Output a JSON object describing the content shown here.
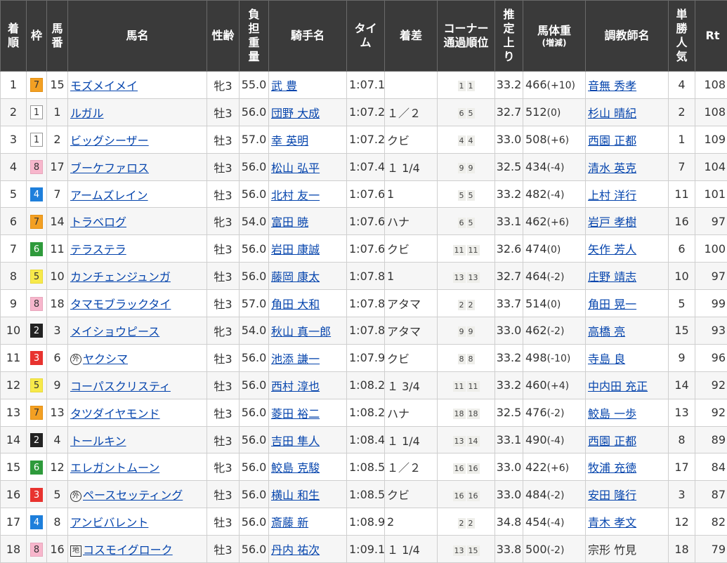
{
  "headers": {
    "rank": [
      "着",
      "順"
    ],
    "waku": "枠",
    "num": [
      "馬",
      "番"
    ],
    "name": "馬名",
    "sexage": "性齢",
    "weight": [
      "負",
      "担",
      "重",
      "量"
    ],
    "jockey": "騎手名",
    "time": [
      "タイ",
      "ム"
    ],
    "margin": "着差",
    "corner": [
      "コーナー",
      "通過順位"
    ],
    "last3f": [
      "推",
      "定",
      "上",
      "り"
    ],
    "body": [
      "馬体重",
      "(増減)"
    ],
    "trainer": "調教師名",
    "pop": [
      "単",
      "勝",
      "人",
      "気"
    ],
    "rt": "Rt"
  },
  "waku_colors": {
    "1": "#ffffff",
    "2": "#222222",
    "3": "#e8332f",
    "4": "#1e7fdb",
    "5": "#f7e94a",
    "6": "#2e9a3b",
    "7": "#f3a023",
    "8": "#f7b6cc"
  },
  "rows": [
    {
      "rank": "1",
      "waku": "7",
      "num": "15",
      "mark": "",
      "horse": "モズメイメイ",
      "sexage": "牝3",
      "weight": "55.0",
      "jockey": "武 豊",
      "time": "1:07.1",
      "margin": "",
      "corner": [
        "1",
        "1"
      ],
      "last3f": "33.2",
      "body": "466",
      "diff": "(+10)",
      "trainer": "音無 秀孝",
      "trainer_link": true,
      "pop": "4",
      "rt": "108"
    },
    {
      "rank": "2",
      "waku": "1",
      "num": "1",
      "mark": "",
      "horse": "ルガル",
      "sexage": "牡3",
      "weight": "56.0",
      "jockey": "団野 大成",
      "time": "1:07.2",
      "margin": "１／２",
      "corner": [
        "6",
        "5"
      ],
      "last3f": "32.7",
      "body": "512",
      "diff": "(0)",
      "trainer": "杉山 晴紀",
      "trainer_link": true,
      "pop": "2",
      "rt": "108"
    },
    {
      "rank": "3",
      "waku": "1",
      "num": "2",
      "mark": "",
      "horse": "ビッグシーザー",
      "sexage": "牡3",
      "weight": "57.0",
      "jockey": "幸 英明",
      "time": "1:07.2",
      "margin": "クビ",
      "corner": [
        "4",
        "4"
      ],
      "last3f": "33.0",
      "body": "508",
      "diff": "(+6)",
      "trainer": "西園 正都",
      "trainer_link": true,
      "pop": "1",
      "rt": "109"
    },
    {
      "rank": "4",
      "waku": "8",
      "num": "17",
      "mark": "",
      "horse": "ブーケファロス",
      "sexage": "牡3",
      "weight": "56.0",
      "jockey": "松山 弘平",
      "time": "1:07.4",
      "margin": "１ 1/4",
      "corner": [
        "9",
        "9"
      ],
      "last3f": "32.5",
      "body": "434",
      "diff": "(-4)",
      "trainer": "清水 英克",
      "trainer_link": true,
      "pop": "7",
      "rt": "104"
    },
    {
      "rank": "5",
      "waku": "4",
      "num": "7",
      "mark": "",
      "horse": "アームズレイン",
      "sexage": "牡3",
      "weight": "56.0",
      "jockey": "北村 友一",
      "time": "1:07.6",
      "margin": "1",
      "corner": [
        "5",
        "5"
      ],
      "last3f": "33.2",
      "body": "482",
      "diff": "(-4)",
      "trainer": "上村 洋行",
      "trainer_link": true,
      "pop": "11",
      "rt": "101"
    },
    {
      "rank": "6",
      "waku": "7",
      "num": "14",
      "mark": "",
      "horse": "トラベログ",
      "sexage": "牝3",
      "weight": "54.0",
      "jockey": "富田 暁",
      "time": "1:07.6",
      "margin": "ハナ",
      "corner": [
        "6",
        "5"
      ],
      "last3f": "33.1",
      "body": "462",
      "diff": "(+6)",
      "trainer": "岩戸 孝樹",
      "trainer_link": true,
      "pop": "16",
      "rt": "97"
    },
    {
      "rank": "7",
      "waku": "6",
      "num": "11",
      "mark": "",
      "horse": "テラステラ",
      "sexage": "牡3",
      "weight": "56.0",
      "jockey": "岩田 康誠",
      "time": "1:07.6",
      "margin": "クビ",
      "corner": [
        "11",
        "11"
      ],
      "last3f": "32.6",
      "body": "474",
      "diff": "(0)",
      "trainer": "矢作 芳人",
      "trainer_link": true,
      "pop": "6",
      "rt": "100"
    },
    {
      "rank": "8",
      "waku": "5",
      "num": "10",
      "mark": "",
      "horse": "カンチェンジュンガ",
      "sexage": "牡3",
      "weight": "56.0",
      "jockey": "藤岡 康太",
      "time": "1:07.8",
      "margin": "1",
      "corner": [
        "13",
        "13"
      ],
      "last3f": "32.7",
      "body": "464",
      "diff": "(-2)",
      "trainer": "庄野 靖志",
      "trainer_link": true,
      "pop": "10",
      "rt": "97"
    },
    {
      "rank": "9",
      "waku": "8",
      "num": "18",
      "mark": "",
      "horse": "タマモブラックタイ",
      "sexage": "牡3",
      "weight": "57.0",
      "jockey": "角田 大和",
      "time": "1:07.8",
      "margin": "アタマ",
      "corner": [
        "2",
        "2"
      ],
      "last3f": "33.7",
      "body": "514",
      "diff": "(0)",
      "trainer": "角田 晃一",
      "trainer_link": true,
      "pop": "5",
      "rt": "99"
    },
    {
      "rank": "10",
      "waku": "2",
      "num": "3",
      "mark": "",
      "horse": "メイショウピース",
      "sexage": "牝3",
      "weight": "54.0",
      "jockey": "秋山 真一郎",
      "time": "1:07.8",
      "margin": "アタマ",
      "corner": [
        "9",
        "9"
      ],
      "last3f": "33.0",
      "body": "462",
      "diff": "(-2)",
      "trainer": "高橋 亮",
      "trainer_link": true,
      "pop": "15",
      "rt": "93"
    },
    {
      "rank": "11",
      "waku": "3",
      "num": "6",
      "mark": "外",
      "horse": "ヤクシマ",
      "sexage": "牡3",
      "weight": "56.0",
      "jockey": "池添 謙一",
      "time": "1:07.9",
      "margin": "クビ",
      "corner": [
        "8",
        "8"
      ],
      "last3f": "33.2",
      "body": "498",
      "diff": "(-10)",
      "trainer": "寺島 良",
      "trainer_link": true,
      "pop": "9",
      "rt": "96"
    },
    {
      "rank": "12",
      "waku": "5",
      "num": "9",
      "mark": "",
      "horse": "コーパスクリスティ",
      "sexage": "牡3",
      "weight": "56.0",
      "jockey": "西村 淳也",
      "time": "1:08.2",
      "margin": "１ 3/4",
      "corner": [
        "11",
        "11"
      ],
      "last3f": "33.2",
      "body": "460",
      "diff": "(+4)",
      "trainer": "中内田 充正",
      "trainer_link": true,
      "pop": "14",
      "rt": "92"
    },
    {
      "rank": "13",
      "waku": "7",
      "num": "13",
      "mark": "",
      "horse": "タツダイヤモンド",
      "sexage": "牡3",
      "weight": "56.0",
      "jockey": "菱田 裕二",
      "time": "1:08.2",
      "margin": "ハナ",
      "corner": [
        "18",
        "18"
      ],
      "last3f": "32.5",
      "body": "476",
      "diff": "(-2)",
      "trainer": "鮫島 一歩",
      "trainer_link": true,
      "pop": "13",
      "rt": "92"
    },
    {
      "rank": "14",
      "waku": "2",
      "num": "4",
      "mark": "",
      "horse": "トールキン",
      "sexage": "牡3",
      "weight": "56.0",
      "jockey": "吉田 隼人",
      "time": "1:08.4",
      "margin": "１ 1/4",
      "corner": [
        "13",
        "14"
      ],
      "last3f": "33.1",
      "body": "490",
      "diff": "(-4)",
      "trainer": "西園 正都",
      "trainer_link": true,
      "pop": "8",
      "rt": "89"
    },
    {
      "rank": "15",
      "waku": "6",
      "num": "12",
      "mark": "",
      "horse": "エレガントムーン",
      "sexage": "牝3",
      "weight": "56.0",
      "jockey": "鮫島 克駿",
      "time": "1:08.5",
      "margin": "１／２",
      "corner": [
        "16",
        "16"
      ],
      "last3f": "33.0",
      "body": "422",
      "diff": "(+6)",
      "trainer": "牧浦 充徳",
      "trainer_link": true,
      "pop": "17",
      "rt": "84"
    },
    {
      "rank": "16",
      "waku": "3",
      "num": "5",
      "mark": "外",
      "horse": "ペースセッティング",
      "sexage": "牡3",
      "weight": "56.0",
      "jockey": "横山 和生",
      "time": "1:08.5",
      "margin": "クビ",
      "corner": [
        "16",
        "16"
      ],
      "last3f": "33.0",
      "body": "484",
      "diff": "(-2)",
      "trainer": "安田 隆行",
      "trainer_link": true,
      "pop": "3",
      "rt": "87"
    },
    {
      "rank": "17",
      "waku": "4",
      "num": "8",
      "mark": "",
      "horse": "アンビバレント",
      "sexage": "牡3",
      "weight": "56.0",
      "jockey": "斎藤 新",
      "time": "1:08.9",
      "margin": "2",
      "corner": [
        "2",
        "2"
      ],
      "last3f": "34.8",
      "body": "454",
      "diff": "(-4)",
      "trainer": "青木 孝文",
      "trainer_link": true,
      "pop": "12",
      "rt": "82"
    },
    {
      "rank": "18",
      "waku": "8",
      "num": "16",
      "mark": "地",
      "horse": "コスモイグローク",
      "sexage": "牡3",
      "weight": "56.0",
      "jockey": "丹内 祐次",
      "time": "1:09.1",
      "margin": "１ 1/4",
      "corner": [
        "13",
        "15"
      ],
      "last3f": "33.8",
      "body": "500",
      "diff": "(-2)",
      "trainer": "宗形 竹見",
      "trainer_link": false,
      "pop": "18",
      "rt": "79"
    }
  ]
}
